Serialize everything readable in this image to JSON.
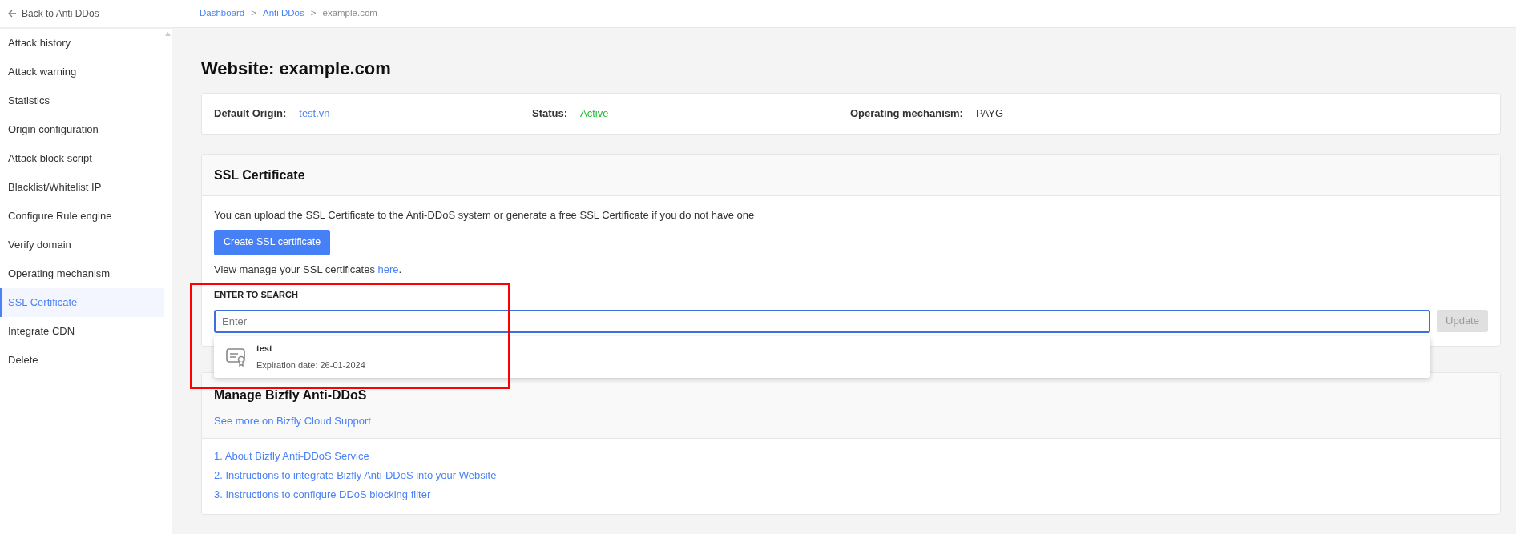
{
  "sidebar": {
    "back_link": "Back to Anti DDos",
    "items": [
      {
        "label": "Attack history",
        "selected": false
      },
      {
        "label": "Attack warning",
        "selected": false
      },
      {
        "label": "Statistics",
        "selected": false
      },
      {
        "label": "Origin configuration",
        "selected": false
      },
      {
        "label": "Attack block script",
        "selected": false
      },
      {
        "label": "Blacklist/Whitelist IP",
        "selected": false
      },
      {
        "label": "Configure Rule engine",
        "selected": false
      },
      {
        "label": "Verify domain",
        "selected": false
      },
      {
        "label": "Operating mechanism",
        "selected": false
      },
      {
        "label": "SSL Certificate",
        "selected": true
      },
      {
        "label": "Integrate CDN",
        "selected": false
      },
      {
        "label": "Delete",
        "selected": false
      }
    ]
  },
  "breadcrumb": [
    {
      "label": "Dashboard",
      "kind": "link"
    },
    {
      "label": "Anti DDos",
      "kind": "link"
    },
    {
      "label": "example.com",
      "kind": "current"
    }
  ],
  "breadcrumb_separator": ">",
  "page_title": "Website: example.com",
  "info": [
    {
      "label": "Default Origin:",
      "value": "test.vn",
      "kind": "link"
    },
    {
      "label": "Status:",
      "value": "Active",
      "kind": "success"
    },
    {
      "label": "Operating mechanism:",
      "value": "PAYG",
      "kind": "plain"
    }
  ],
  "ssl_card": {
    "title": "SSL Certificate",
    "description": "You can upload the SSL Certificate to the Anti-DDoS system or generate a free SSL Certificate if you do not have one",
    "create_button": "Create SSL certificate",
    "manage_text": "View manage your SSL certificates ",
    "manage_link": "here",
    "manage_suffix": ".",
    "search_label": "ENTER TO SEARCH",
    "search": {
      "placeholder": "Enter"
    },
    "update_button": {
      "label": "Update",
      "disabled": true
    },
    "results": [
      {
        "name": "test",
        "expiration": "Expiration date: 26-01-2024"
      }
    ]
  },
  "manage_card": {
    "title": "Manage Bizfly Anti-DDoS",
    "support_link": "See more on Bizfly Cloud Support",
    "links": [
      "1. About Bizfly Anti-DDoS Service",
      "2. Instructions to integrate Bizfly Anti-DDoS into your Website",
      "3. Instructions to configure DDoS blocking filter"
    ]
  }
}
